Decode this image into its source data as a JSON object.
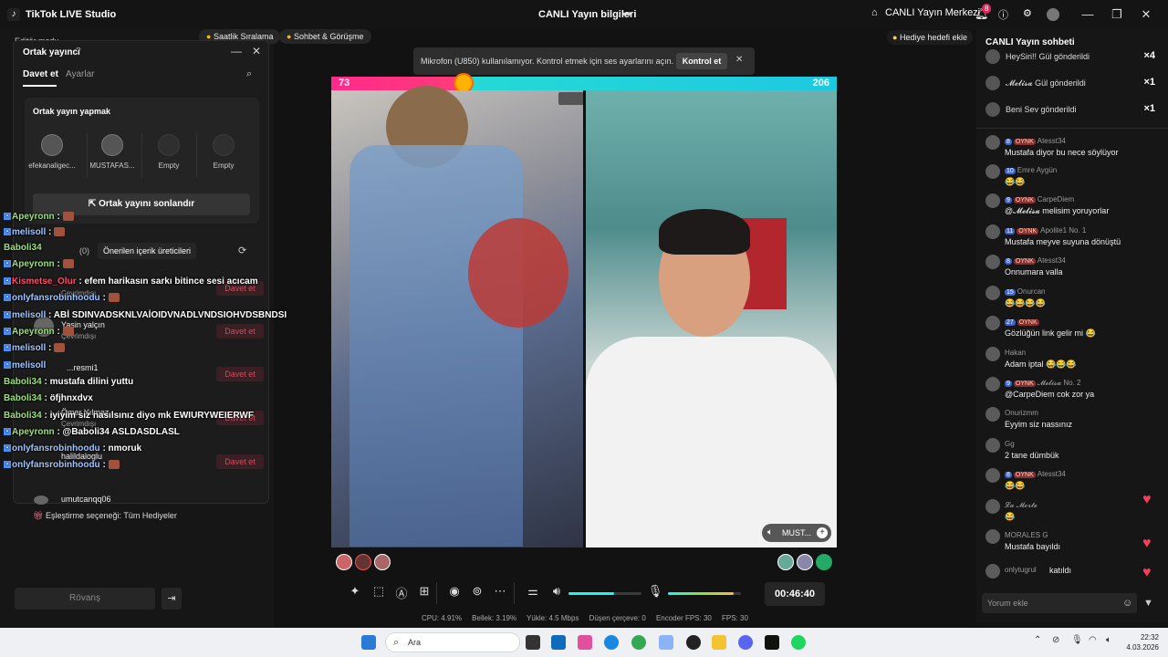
{
  "titlebar": {
    "app_title": "TikTok LIVE Studio",
    "center_title": "CANLI Yayın bilgileri",
    "center_link": "CANLI Yayın Merkezi",
    "notif_count": "8"
  },
  "left": {
    "chip1": "Saatlik Sıralama",
    "chip2": "Sohbet & Görüşme",
    "editor_mode": "Editör modu",
    "panel_title": "Ortak yayıncı",
    "tab_invite": "Davet et",
    "tab_settings": "Ayarlar",
    "card_title": "Ortak yayın yapmak",
    "slots": [
      "efekanaligec...",
      "MUSTAFAS...",
      "Empty",
      "Empty"
    ],
    "end_btn": "Ortak yayını sonlandır",
    "suggest_count": "(0)",
    "suggest_label": "Önerilen içerik üreticileri",
    "invite_label": "Davet et",
    "offline": "Çevrimdışı",
    "candidates": [
      "Yasin yalçın",
      "...resmi1",
      "Ömer Yılmaz",
      "halildaloglu",
      "umutcanqq06"
    ],
    "match_option": "Eşleştirme seçeneği: Tüm Hediyeler",
    "rematch": "Rövanş"
  },
  "overlay_chat": [
    {
      "name": "Apeyronn",
      "text": ":"
    },
    {
      "name": "melisoll",
      "text": ":"
    },
    {
      "name": "Baboli34",
      "text": ""
    },
    {
      "name": "Apeyronn",
      "text": ":"
    },
    {
      "name": "Kismetse_Olur",
      "text": ": efem harikasın sarkı bitince sesi acıcam"
    },
    {
      "name": "onlyfansrobinhoodu",
      "text": ":"
    },
    {
      "name": "melisoll",
      "text": ": ABİ SDINVADSKNLVAİOIDVNADLVNDSIOHVDSBNDSI"
    },
    {
      "name": "Apeyronn",
      "text": ":"
    },
    {
      "name": "melisoll",
      "text": ":"
    },
    {
      "name": "melisoll",
      "text": ""
    },
    {
      "name": "Baboli34",
      "text": ": mustafa dilini yuttu"
    },
    {
      "name": "Baboli34",
      "text": ": öfjhnxdvx"
    },
    {
      "name": "Baboli34",
      "text": ": iyiyim siz nasılsınız diyo mk EWIURYWEIERWF"
    },
    {
      "name": "Apeyronn",
      "text": ": @Baboli34 ASLDASDLASL"
    },
    {
      "name": "onlyfansrobinhoodu",
      "text": ": nmoruk"
    },
    {
      "name": "onlyfansrobinhoodu",
      "text": ":"
    }
  ],
  "toast": {
    "text": "Mikrofon (U850) kullanılamıyor. Kontrol etmek için ses ayarlarını açın.",
    "button": "Kontrol et"
  },
  "gift_goal": "Hediye hedefi ekle",
  "video": {
    "score_left": "73",
    "score_right": "206",
    "guest_label": "MUST..."
  },
  "controls": {
    "timer": "00:46:40",
    "volume_level": 0.62,
    "mic_level": 0.9
  },
  "status": {
    "cpu": "CPU:  4.91%",
    "mem": "Bellek:  3.19%",
    "upload": "Yükle:  4.5 Mbps",
    "dropped": "Düşen çerçeve:  0",
    "enc_fps": "Encoder FPS:  30",
    "fps": "FPS:  30"
  },
  "chat": {
    "title": "CANLI Yayın sohbeti",
    "gifts": [
      {
        "text": "HeySiri!! Gül gönderildi",
        "count": "×4"
      },
      {
        "text": "𝓜𝓮𝓵𝓲𝓼𝓪 Gül gönderildi",
        "count": "×1"
      },
      {
        "text": "Beni Sev gönderildi",
        "count": "×1"
      }
    ],
    "messages": [
      {
        "lv": "8",
        "tag": "OYNK",
        "user": "Atesst34",
        "text": "Mustafa diyor bu nece söylüyor"
      },
      {
        "lv": "10",
        "tag": "",
        "user": "Emre Aygün",
        "text": "😂😂"
      },
      {
        "lv": "9",
        "tag": "OYNK",
        "user": "CarpeDiem",
        "text": "@𝓜𝓮𝓵𝓲𝓼𝓪 melisim yoruyorlar"
      },
      {
        "lv": "11",
        "tag": "OYNK",
        "user": "Apolite1  No. 1",
        "text": "Mustafa meyve suyuna dönüştü"
      },
      {
        "lv": "8",
        "tag": "OYNK",
        "user": "Atesst34",
        "text": "Onnumara valla"
      },
      {
        "lv": "15",
        "tag": "",
        "user": "Onurcan",
        "text": "😂😂😂😂"
      },
      {
        "lv": "27",
        "tag": "OYNK",
        "user": "",
        "text": "Gözlüğün link gelir mi 😂"
      },
      {
        "lv": "",
        "tag": "",
        "user": "Hakan",
        "text": "Adam iptal 😂😂😂"
      },
      {
        "lv": "9",
        "tag": "OYNK",
        "user": "𝓜𝓮𝓵𝓲𝓼𝓪  No. 2",
        "text": "@CarpeDiem cok zor ya"
      },
      {
        "lv": "",
        "tag": "",
        "user": "Onurizmm",
        "text": "Eyyim siz nassınız"
      },
      {
        "lv": "",
        "tag": "",
        "user": "Gg",
        "text": "2 tane dümbük"
      },
      {
        "lv": "8",
        "tag": "OYNK",
        "user": "Atesst34",
        "text": "😂😂"
      },
      {
        "lv": "",
        "tag": "",
        "user": "𝓛𝓪 𝓜𝓸𝓻𝓽𝓮",
        "text": "😂"
      },
      {
        "lv": "",
        "tag": "",
        "user": "MORALES G",
        "text": "Mustafa bayıldı"
      },
      {
        "lv": "",
        "tag": "",
        "user": "onlytugrul",
        "text": "katıldı"
      }
    ],
    "input_placeholder": "Yorum ekle"
  },
  "taskbar": {
    "search": "Ara",
    "time": "22:32",
    "date": "4.03.2026"
  }
}
